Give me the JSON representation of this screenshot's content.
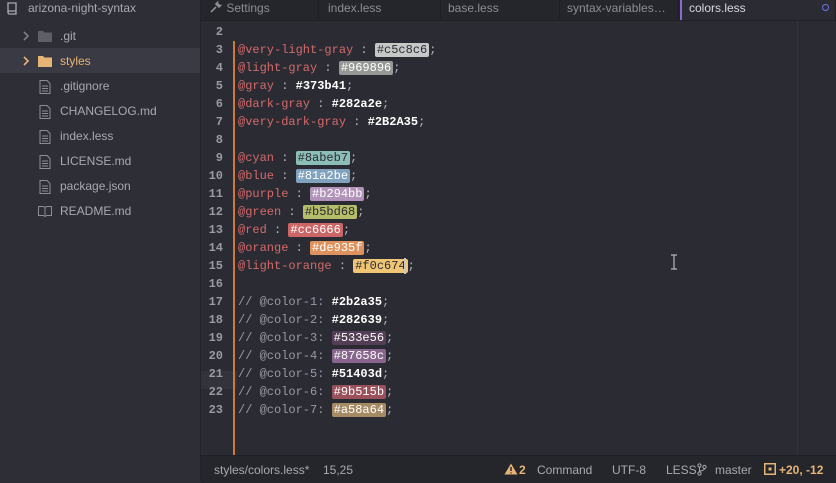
{
  "sidebar": {
    "root": "arizona-night-syntax",
    "items": [
      {
        "label": ".git",
        "type": "folder"
      },
      {
        "label": "styles",
        "type": "folder"
      },
      {
        "label": ".gitignore",
        "type": "file"
      },
      {
        "label": "CHANGELOG.md",
        "type": "file"
      },
      {
        "label": "index.less",
        "type": "file"
      },
      {
        "label": "LICENSE.md",
        "type": "file"
      },
      {
        "label": "package.json",
        "type": "file"
      },
      {
        "label": "README.md",
        "type": "file"
      }
    ]
  },
  "tabs": [
    {
      "label": "Settings",
      "icon": "wrench-icon"
    },
    {
      "label": "index.less"
    },
    {
      "label": "base.less"
    },
    {
      "label": "syntax-variables…"
    },
    {
      "label": "colors.less",
      "active": true
    }
  ],
  "editor": {
    "lines": [
      {
        "n": "2"
      },
      {
        "n": "3",
        "name": "@very-light-gray",
        "hex": "#c5c8c6",
        "swatch": "#c5c8c6",
        "text": "#2b2b33"
      },
      {
        "n": "4",
        "name": "@light-gray",
        "hex": "#969896",
        "swatch": "#969896",
        "text": "#ffffff"
      },
      {
        "n": "5",
        "name": "@gray",
        "hex": "#373b41"
      },
      {
        "n": "6",
        "name": "@dark-gray",
        "hex": "#282a2e"
      },
      {
        "n": "7",
        "name": "@very-dark-gray",
        "hex": "#2B2A35"
      },
      {
        "n": "8"
      },
      {
        "n": "9",
        "name": "@cyan",
        "hex": "#8abeb7",
        "swatch": "#8abeb7",
        "text": "#2b2b33"
      },
      {
        "n": "10",
        "name": "@blue",
        "hex": "#81a2be",
        "swatch": "#81a2be",
        "text": "#ffffff"
      },
      {
        "n": "11",
        "name": "@purple",
        "hex": "#b294bb",
        "swatch": "#b294bb",
        "text": "#ffffff"
      },
      {
        "n": "12",
        "name": "@green",
        "hex": "#b5bd68",
        "swatch": "#b5bd68",
        "text": "#2b2b33"
      },
      {
        "n": "13",
        "name": "@red",
        "hex": "#cc6666",
        "swatch": "#cc6666",
        "text": "#ffffff"
      },
      {
        "n": "14",
        "name": "@orange",
        "hex": "#de935f",
        "swatch": "#de935f",
        "text": "#ffffff"
      },
      {
        "n": "15",
        "name": "@light-orange",
        "hex": "#f0c674",
        "swatch": "#f0c674",
        "text": "#2b2b33"
      },
      {
        "n": "16"
      },
      {
        "n": "17",
        "comment": "// @color-1:",
        "hex": "#2b2a35"
      },
      {
        "n": "18",
        "comment": "// @color-2:",
        "hex": "#282639"
      },
      {
        "n": "19",
        "comment": "// @color-3:",
        "hex": "#533e56",
        "swatch": "#533e56",
        "text": "#ffffff"
      },
      {
        "n": "20",
        "comment": "// @color-4:",
        "hex": "#87658c",
        "swatch": "#87658c",
        "text": "#ffffff"
      },
      {
        "n": "21",
        "comment": "// @color-5:",
        "hex": "#51403d"
      },
      {
        "n": "22",
        "comment": "// @color-6:",
        "hex": "#9b515b",
        "swatch": "#9b515b",
        "text": "#ffffff"
      },
      {
        "n": "23",
        "comment": "// @color-7:",
        "hex": "#a58a64",
        "swatch": "#a58a64",
        "text": "#ffffff"
      }
    ]
  },
  "status": {
    "file": "styles/colors.less*",
    "cursor": "15,25",
    "warnings": "2",
    "mode": "Command",
    "encoding": "UTF-8",
    "grammar": "LESS",
    "branch": "master",
    "diff": "+20, -12"
  },
  "colors": {
    "accent": "#e6b476",
    "tab_active_border": "#8a6bd1",
    "variable": "#d46a6a",
    "gutter_modified": "#cf7a3a"
  }
}
